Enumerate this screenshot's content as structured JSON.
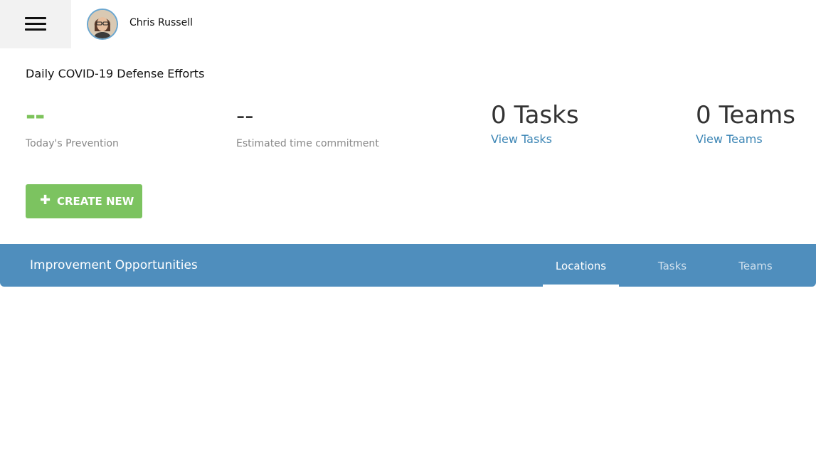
{
  "user": {
    "name": "Chris Russell",
    "avatar_icon": "user-avatar-photo"
  },
  "menu": {
    "icon": "hamburger-menu-icon"
  },
  "dashboard": {
    "title": "Daily COVID-19 Defense Efforts",
    "prevention": {
      "value": "--",
      "label": "Today's Prevention",
      "color": "#7dc35b"
    },
    "time_commitment": {
      "value": "--",
      "label": "Estimated time commitment"
    },
    "tasks": {
      "value": "0 Tasks",
      "link": "View Tasks"
    },
    "teams": {
      "value": "0 Teams",
      "link": "View Teams"
    },
    "create_button": {
      "label": "CREATE NEW",
      "icon": "plus-icon",
      "color": "#7cc360"
    }
  },
  "opportunities": {
    "title": "Improvement Opportunities",
    "bar_color": "#4f8ebd",
    "tabs": [
      {
        "label": "Locations",
        "active": true
      },
      {
        "label": "Tasks",
        "active": false
      },
      {
        "label": "Teams",
        "active": false
      }
    ]
  }
}
